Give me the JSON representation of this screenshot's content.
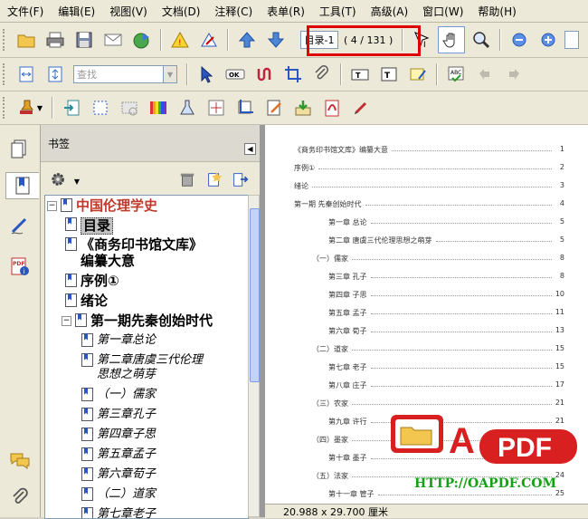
{
  "menu": [
    "文件(F)",
    "编辑(E)",
    "视图(V)",
    "文档(D)",
    "注释(C)",
    "表单(R)",
    "工具(T)",
    "高级(A)",
    "窗口(W)",
    "帮助(H)"
  ],
  "toolbar": {
    "page_box": "目录-1",
    "page_count": "( 4 / 131 )",
    "find_placeholder": "查找"
  },
  "bookmarks": {
    "panel_title": "书签",
    "items": [
      {
        "label": "中国伦理学史",
        "level": 0
      },
      {
        "label": "目录",
        "level": 1
      },
      {
        "label": "《商务印书馆文库》",
        "level": 1
      },
      {
        "label": "编纂大意",
        "level": 1
      },
      {
        "label": "序例①",
        "level": 1
      },
      {
        "label": "绪论",
        "level": 1
      },
      {
        "label": "第一期先秦创始时代",
        "level": 1
      },
      {
        "label": "第一章总论",
        "level": 2
      },
      {
        "label": "第二章唐虞三代伦理",
        "level": 2
      },
      {
        "label": "思想之萌芽",
        "level": 2
      },
      {
        "label": "（一）儒家",
        "level": 2
      },
      {
        "label": "第三章孔子",
        "level": 2
      },
      {
        "label": "第四章子思",
        "level": 2
      },
      {
        "label": "第五章孟子",
        "level": 2
      },
      {
        "label": "第六章荀子",
        "level": 2
      },
      {
        "label": "（二）道家",
        "level": 2
      },
      {
        "label": "第七章老子",
        "level": 2
      }
    ]
  },
  "document": {
    "toc": [
      {
        "title": "《商务印书馆文库》编纂大意",
        "page": "1"
      },
      {
        "title": "序例①",
        "page": "2"
      },
      {
        "title": "绪论",
        "page": "3"
      },
      {
        "title": "第一期  先秦创始时代",
        "page": "4"
      },
      {
        "title": "第一章  总论",
        "page": "5"
      },
      {
        "title": "第二章  唐虞三代伦理思想之萌芽",
        "page": "5"
      },
      {
        "title": "（一）儒家",
        "page": "8"
      },
      {
        "title": "第三章  孔子",
        "page": "8"
      },
      {
        "title": "第四章  子思",
        "page": "10"
      },
      {
        "title": "第五章  孟子",
        "page": "11"
      },
      {
        "title": "第六章  荀子",
        "page": "13"
      },
      {
        "title": "（二）道家",
        "page": "15"
      },
      {
        "title": "第七章  老子",
        "page": "15"
      },
      {
        "title": "第八章  庄子",
        "page": "17"
      },
      {
        "title": "（三）农家",
        "page": "21"
      },
      {
        "title": "第九章  许行",
        "page": "21"
      },
      {
        "title": "（四）墨家",
        "page": "22"
      },
      {
        "title": "第十章  墨子",
        "page": "22"
      },
      {
        "title": "（五）法家",
        "page": "24"
      },
      {
        "title": "第十一章  管子",
        "page": "25"
      }
    ]
  },
  "status": {
    "page_size": "20.988 x 29.700 厘米"
  },
  "watermark": {
    "brand_letter": "A",
    "brand": "PDF",
    "url": "HTTP://OAPDF.COM"
  },
  "colors": {
    "highlight_frame": "#e00000",
    "bookmark_root": "#c0392b",
    "watermark_red": "#d82020",
    "watermark_url": "#16a016"
  }
}
